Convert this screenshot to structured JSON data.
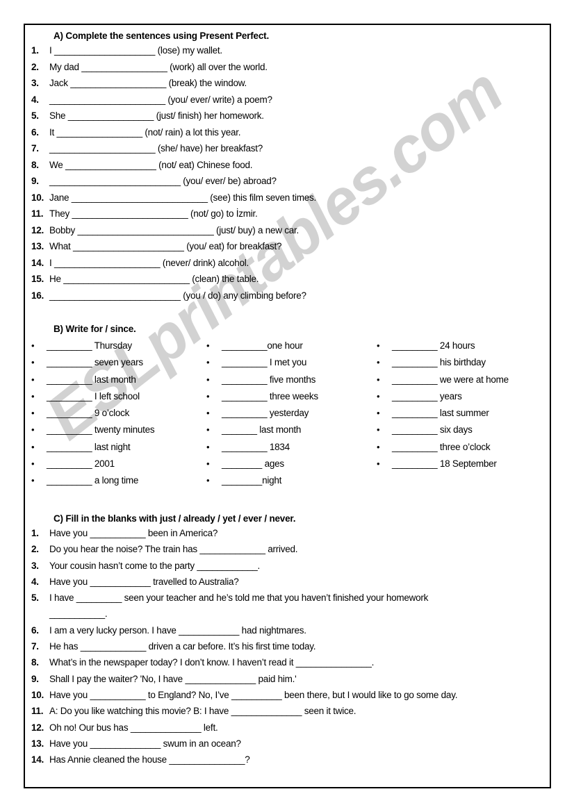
{
  "watermark": {
    "text": "ESLprintables.com",
    "color": "#d2d2d2"
  },
  "exercise_a": {
    "heading": "A)  Complete the sentences using Present Perfect.",
    "items": [
      {
        "num": "1.",
        "text": "I ____________________ (lose) my wallet."
      },
      {
        "num": "2.",
        "text": "My dad _________________ (work) all over the world."
      },
      {
        "num": "3.",
        "text": "Jack ___________________ (break) the window."
      },
      {
        "num": "4.",
        "text": "_______________________ (you/ ever/ write) a poem?"
      },
      {
        "num": "5.",
        "text": "She _________________ (just/ finish) her homework."
      },
      {
        "num": "6.",
        "text": "It _________________ (not/ rain) a lot this year."
      },
      {
        "num": "7.",
        "text": "_____________________ (she/ have) her breakfast?"
      },
      {
        "num": "8.",
        "text": "We __________________ (not/ eat) Chinese food."
      },
      {
        "num": "9.",
        "text": "__________________________ (you/ ever/ be) abroad?"
      },
      {
        "num": "10.",
        "text": "Jane ___________________________ (see) this film seven times."
      },
      {
        "num": "11.",
        "text": "They _______________________ (not/ go) to İzmir."
      },
      {
        "num": "12.",
        "text": "Bobby ___________________________ (just/ buy) a new car."
      },
      {
        "num": "13.",
        "text": "What ______________________ (you/ eat) for breakfast?"
      },
      {
        "num": "14.",
        "text": "I _____________________ (never/ drink) alcohol."
      },
      {
        "num": "15.",
        "text": "He _________________________ (clean) the table."
      },
      {
        "num": "16.",
        "text": "__________________________ (you / do) any climbing before?"
      }
    ]
  },
  "exercise_b": {
    "heading": "B)  Write for / since.",
    "columns": [
      {
        "items": [
          "_________ Thursday",
          "_________  seven years",
          "_________ last month",
          "_________ I left school",
          "_________ 9 o’clock",
          "_________  twenty minutes",
          "_________ last night",
          "_________  2001",
          "_________  a long time"
        ]
      },
      {
        "items": [
          "_________one hour",
          "_________ I met you",
          "_________  five months",
          "_________  three weeks",
          "_________ yesterday",
          "_______ last month",
          "_________ 1834",
          "________ ages",
          "________night"
        ]
      },
      {
        "items": [
          "_________  24 hours",
          "_________  his birthday",
          "_________  we were at home",
          "_________ years",
          "_________  last summer",
          "_________  six days",
          "_________  three o’clock",
          "_________  18 September"
        ]
      }
    ]
  },
  "exercise_c": {
    "heading": "C)  Fill in the blanks with just / already / yet / ever / never.",
    "items": [
      {
        "num": "1.",
        "text": "Have you ___________ been in America?"
      },
      {
        "num": "2.",
        "text": "Do you hear the noise? The train has _____________ arrived."
      },
      {
        "num": "3.",
        "text": "Your cousin hasn’t come to the party ____________."
      },
      {
        "num": "4.",
        "text": "Have you ____________ travelled to Australia?"
      },
      {
        "num": "5.",
        "text": "I have _________ seen your teacher and he’s told me that you haven’t finished your homework",
        "wrap": "___________."
      },
      {
        "num": "6.",
        "text": "I am a very lucky person. I have ____________ had nightmares."
      },
      {
        "num": "7.",
        "text": "He has _____________ driven a car before. It’s his first time today."
      },
      {
        "num": "8.",
        "text": "What’s in the newspaper today? I don’t know. I haven’t read it _______________."
      },
      {
        "num": "9.",
        "text": "Shall I pay the waiter? 'No, I have ______________ paid him.'"
      },
      {
        "num": "10.",
        "text": "Have you ___________ to England?  No, I’ve __________ been there, but I would like to go some day."
      },
      {
        "num": "11.",
        "text": "A: Do you like watching this movie? B: I have ______________ seen it twice."
      },
      {
        "num": "12.",
        "text": "Oh no! Our bus has ______________ left."
      },
      {
        "num": "13.",
        "text": "Have you ______________ swum in an ocean?"
      },
      {
        "num": "14.",
        "text": "Has Annie cleaned the house _______________?"
      }
    ]
  }
}
